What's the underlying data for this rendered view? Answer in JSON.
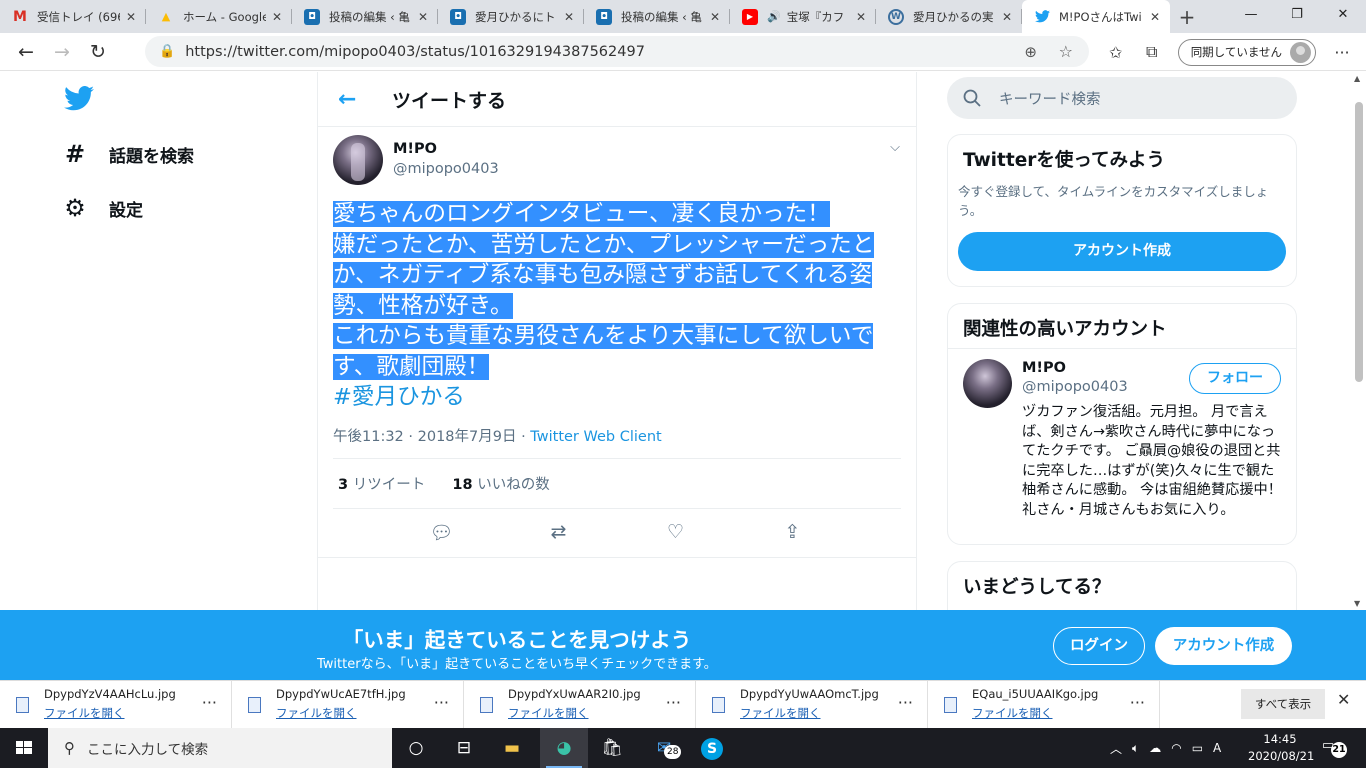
{
  "browser": {
    "tabs": [
      {
        "title": "受信トレイ (696",
        "icon": "gmail-icon",
        "color": "#d93025",
        "glyph": "M"
      },
      {
        "title": "ホーム - Google",
        "icon": "google-ads-icon",
        "color": "#fbbc04",
        "glyph": "▲"
      },
      {
        "title": "投稿の編集 ‹ 亀",
        "icon": "page-icon",
        "color": "#1a6fb0",
        "glyph": "◘"
      },
      {
        "title": "愛月ひかるにト",
        "icon": "page-icon",
        "color": "#1a6fb0",
        "glyph": "◘"
      },
      {
        "title": "投稿の編集 ‹ 亀",
        "icon": "page-icon",
        "color": "#1a6fb0",
        "glyph": "◘"
      },
      {
        "title": "宝塚『カフ",
        "icon": "youtube-icon",
        "color": "#ff0000",
        "glyph": "▶"
      },
      {
        "title": "愛月ひかるの実",
        "icon": "wordpress-icon",
        "color": "#3c6f9e",
        "glyph": "W"
      },
      {
        "title": "M!POさんはTwi",
        "icon": "twitter-icon",
        "color": "#1da1f2",
        "glyph": "🐦"
      }
    ],
    "url": "https://twitter.com/mipopo0403/status/1016329194387562497",
    "sync_label": "同期していません"
  },
  "nav": {
    "explore": "話題を検索",
    "settings": "設定"
  },
  "tweet": {
    "header": "ツイートする",
    "name": "M!PO",
    "handle": "@mipopo0403",
    "lines": [
      "愛ちゃんのロングインタビュー、凄く良かった！",
      "嫌だったとか、苦労したとか、プレッシャーだったとか、ネガティブ系な事も包み隠さずお話してくれる姿勢、性格が好き。",
      "これからも貴重な男役さんをより大事にして欲しいです、歌劇団殿！"
    ],
    "hashtag": "#愛月ひかる",
    "time": "午後11:32 · 2018年7月9日 · ",
    "client": "Twitter Web Client",
    "retweets": "3",
    "retweets_label": "リツイート",
    "likes": "18",
    "likes_label": "いいねの数"
  },
  "sidebar": {
    "search_placeholder": "キーワード検索",
    "signup_title": "Twitterを使ってみよう",
    "signup_text": "今すぐ登録して、タイムラインをカスタマイズしましょう。",
    "signup_button": "アカウント作成",
    "related_title": "関連性の高いアカウント",
    "related_name": "M!PO",
    "related_handle": "@mipopo0403",
    "follow_button": "フォロー",
    "related_bio": "ヅカファン復活組。元月担。 月で言えば、剣さん→紫吹さん時代に夢中になってたクチです。 ご贔屓@娘役の退団と共に完卒した…はずが(笑)久々に生で観た柚希さんに感動。 今は宙組絶賛応援中！礼さん・月城さんもお気に入り。",
    "trends_title": "いまどうしてる？"
  },
  "banner": {
    "title": "「いま」起きていることを見つけよう",
    "subtitle": "Twitterなら、「いま」起きていることをいち早くチェックできます。",
    "login": "ログイン",
    "signup": "アカウント作成"
  },
  "downloads": {
    "items": [
      {
        "name": "DpypdYzV4AAHcLu.jpg",
        "open": "ファイルを開く"
      },
      {
        "name": "DpypdYwUcAE7tfH.jpg",
        "open": "ファイルを開く"
      },
      {
        "name": "DpypdYxUwAAR2I0.jpg",
        "open": "ファイルを開く"
      },
      {
        "name": "DpypdYyUwAAOmcT.jpg",
        "open": "ファイルを開く"
      },
      {
        "name": "EQau_i5UUAAIKgo.jpg",
        "open": "ファイルを開く"
      }
    ],
    "show_all": "すべて表示"
  },
  "taskbar": {
    "search_placeholder": "ここに入力して検索",
    "mail_badge": "28",
    "time": "14:45",
    "date": "2020/08/21",
    "notifications": "21"
  }
}
